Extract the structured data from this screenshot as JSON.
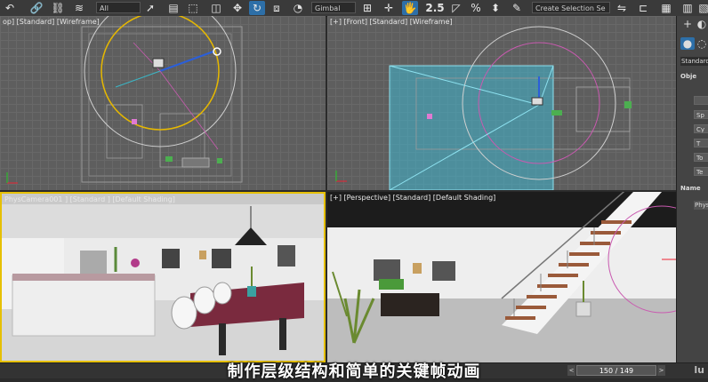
{
  "toolbar": {
    "selection_filter": "All",
    "reference_coord": "Gimbal",
    "snap_label": "2.5",
    "percent_snap": "%",
    "selection_set_placeholder": "Create Selection Se"
  },
  "viewports": {
    "top": {
      "label": "[+] [Top] [Standard] [Wireframe]",
      "label_visible": "op] [Standard] [Wireframe]"
    },
    "front": {
      "label": "[+] [Front] [Standard] [Wireframe]"
    },
    "camera": {
      "label": "PhysCamera001 ] [Standard ] [Default Shading]"
    },
    "perspective": {
      "label": "[+] [Perspective] [Standard] [Default Shading]"
    }
  },
  "command_panel": {
    "category": "Standard",
    "rollout_object_type": "Obje",
    "rollout_name": "Name",
    "buttons": [
      "",
      "Sp",
      "Cy",
      "T",
      "To",
      "Te"
    ],
    "physical_label": "Physi"
  },
  "timeline": {
    "frame_display": "150 / 149",
    "prev_arrow": "<",
    "next_arrow": ">"
  },
  "subtitle": "制作层级结构和简单的关键帧动画",
  "logo": "lu"
}
